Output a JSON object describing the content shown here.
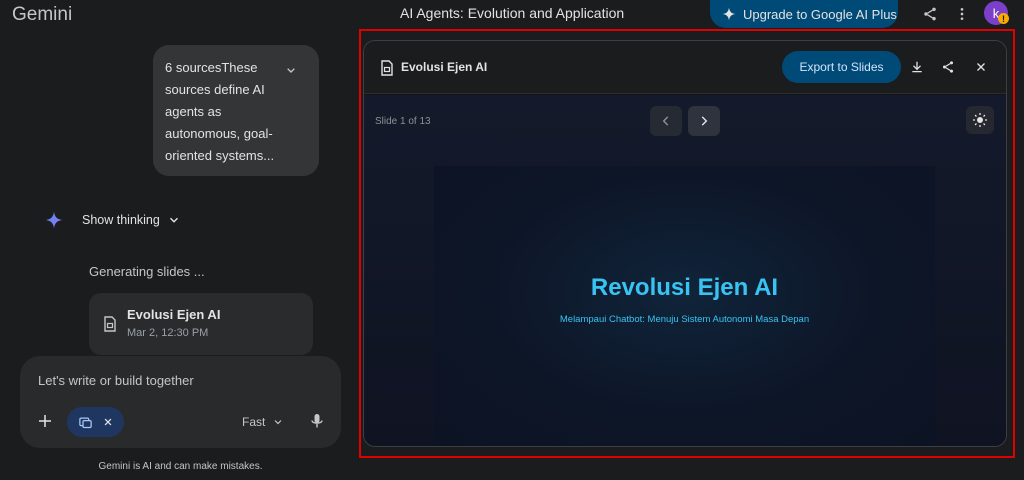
{
  "app": {
    "brand": "Gemini"
  },
  "header": {
    "conversation_title": "AI Agents: Evolution and Application",
    "upgrade_label": "Upgrade to Google AI Plus",
    "avatar_initial": "k",
    "avatar_badge": "!"
  },
  "chat": {
    "user_message": "6 sourcesThese sources define AI agents as autonomous, goal-oriented systems...",
    "show_thinking_label": "Show thinking",
    "status_text": "Generating slides ...",
    "deck_card": {
      "title": "Evolusi Ejen AI",
      "timestamp": "Mar 2, 12:30 PM"
    }
  },
  "composer": {
    "placeholder": "Let's write or build together",
    "mode_label": "Fast"
  },
  "footer": {
    "disclaimer": "Gemini is AI and can make mistakes."
  },
  "canvas": {
    "title": "Evolusi Ejen AI",
    "export_label": "Export to Slides",
    "slide_counter": "Slide 1 of 13",
    "slide": {
      "title": "Revolusi Ejen AI",
      "subtitle": "Melampaui Chatbot: Menuju Sistem Autonomi Masa Depan"
    }
  },
  "colors": {
    "background": "#1b1c1d",
    "accent_button": "#004a77",
    "slide_text": "#38c3f2",
    "highlight_border": "#e00000"
  },
  "icons": [
    "spark-icon",
    "share-icon",
    "more-vert-icon",
    "chevron-down-icon",
    "gemini-spark-icon",
    "slides-doc-icon",
    "plus-icon",
    "tools-icon",
    "close-icon",
    "mic-icon",
    "download-icon",
    "chevron-left-icon",
    "chevron-right-icon",
    "brightness-icon"
  ]
}
